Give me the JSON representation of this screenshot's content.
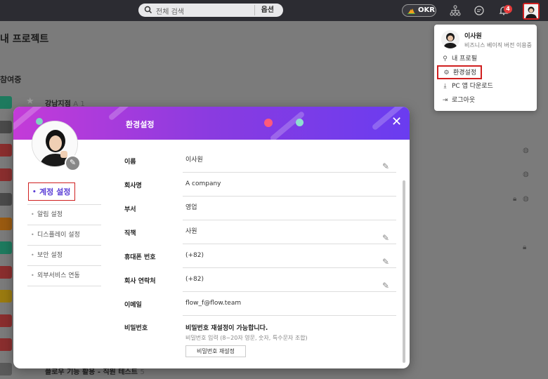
{
  "topbar": {
    "search_placeholder": "전체 검색",
    "search_option": "옵션",
    "okr_label": "OKR",
    "notification_count": "4"
  },
  "background": {
    "page_title": "내 프로젝트",
    "section_label": "참여중",
    "first_project": "강남지점",
    "first_project_count": "A 1",
    "bottom_project": "플로우 기능 활용 - 직원 테스트",
    "bottom_project_count": "5"
  },
  "dropdown": {
    "user_name": "이사원",
    "plan_text": "비즈니스 베이직 버전 이용중",
    "items": [
      {
        "label": "내 프로필",
        "icon": "person-icon"
      },
      {
        "label": "환경설정",
        "icon": "gear-icon"
      },
      {
        "label": "PC 앱 다운로드",
        "icon": "download-icon"
      },
      {
        "label": "로그아웃",
        "icon": "logout-icon"
      }
    ]
  },
  "modal": {
    "title": "환경설정",
    "nav": [
      {
        "label": "계정 설정"
      },
      {
        "label": "알림 설정"
      },
      {
        "label": "디스플레이 설정"
      },
      {
        "label": "보안 설정"
      },
      {
        "label": "외부서비스 연동"
      }
    ],
    "fields": [
      {
        "label": "이름",
        "value": "이사원"
      },
      {
        "label": "회사명",
        "value": "A company"
      },
      {
        "label": "부서",
        "value": "영업"
      },
      {
        "label": "직책",
        "value": "사원"
      },
      {
        "label": "휴대폰 번호",
        "value": "(+82)"
      },
      {
        "label": "회사 연락처",
        "value": "(+82)"
      },
      {
        "label": "이메일",
        "value": "flow_f@flow.team"
      }
    ],
    "password": {
      "label": "비밀번호",
      "status": "비밀번호 재설정이 가능합니다.",
      "hint": "비밀번호 입력 (8~20자 영문, 숫자, 특수문자 조합)",
      "button": "비밀번호 재설정"
    }
  },
  "colors": {
    "accent": "#5a3dd6",
    "highlight": "#d02020",
    "header_gradient_start": "#c43bd8",
    "header_gradient_end": "#6a3cf0"
  }
}
